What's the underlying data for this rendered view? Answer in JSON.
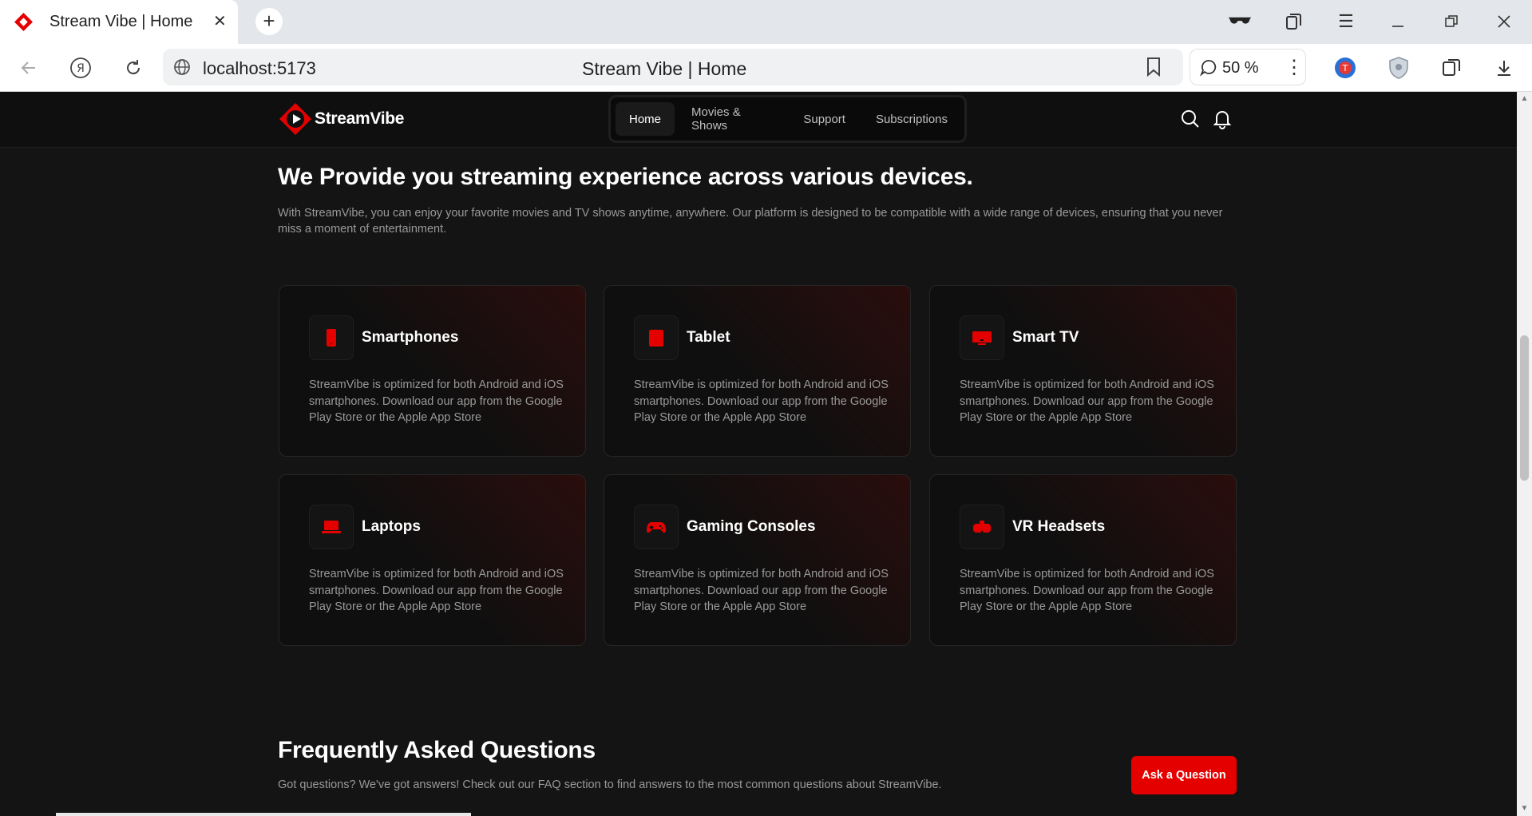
{
  "browser": {
    "tab_title": "Stream Vibe | Home",
    "url": "localhost:5173",
    "page_title": "Stream Vibe | Home",
    "zoom": "50 %"
  },
  "site": {
    "logo_text": "StreamVibe",
    "brand_color": "#e50000",
    "nav": [
      {
        "label": "Home",
        "active": true
      },
      {
        "label": "Movies & Shows",
        "active": false
      },
      {
        "label": "Support",
        "active": false
      },
      {
        "label": "Subscriptions",
        "active": false
      }
    ]
  },
  "devices": {
    "title": "We Provide you streaming experience across various devices.",
    "description": "With StreamVibe, you can enjoy your favorite movies and TV shows anytime, anywhere. Our platform is designed to be compatible with a wide range of devices, ensuring that you never miss a moment of entertainment.",
    "cards": [
      {
        "title": "Smartphones",
        "icon": "smartphone-icon",
        "text": "StreamVibe is optimized for both Android and iOS smartphones. Download our app from the Google Play Store or the Apple App Store"
      },
      {
        "title": "Tablet",
        "icon": "tablet-icon",
        "text": "StreamVibe is optimized for both Android and iOS smartphones. Download our app from the Google Play Store or the Apple App Store"
      },
      {
        "title": "Smart TV",
        "icon": "tv-icon",
        "text": "StreamVibe is optimized for both Android and iOS smartphones. Download our app from the Google Play Store or the Apple App Store"
      },
      {
        "title": "Laptops",
        "icon": "laptop-icon",
        "text": "StreamVibe is optimized for both Android and iOS smartphones. Download our app from the Google Play Store or the Apple App Store"
      },
      {
        "title": "Gaming Consoles",
        "icon": "gamepad-icon",
        "text": "StreamVibe is optimized for both Android and iOS smartphones. Download our app from the Google Play Store or the Apple App Store"
      },
      {
        "title": "VR Headsets",
        "icon": "vr-headset-icon",
        "text": "StreamVibe is optimized for both Android and iOS smartphones. Download our app from the Google Play Store or the Apple App Store"
      }
    ]
  },
  "faq": {
    "title": "Frequently Asked Questions",
    "description": "Got questions? We've got answers! Check out our FAQ section to find answers to the most common questions about StreamVibe.",
    "button_label": "Ask a Question"
  }
}
